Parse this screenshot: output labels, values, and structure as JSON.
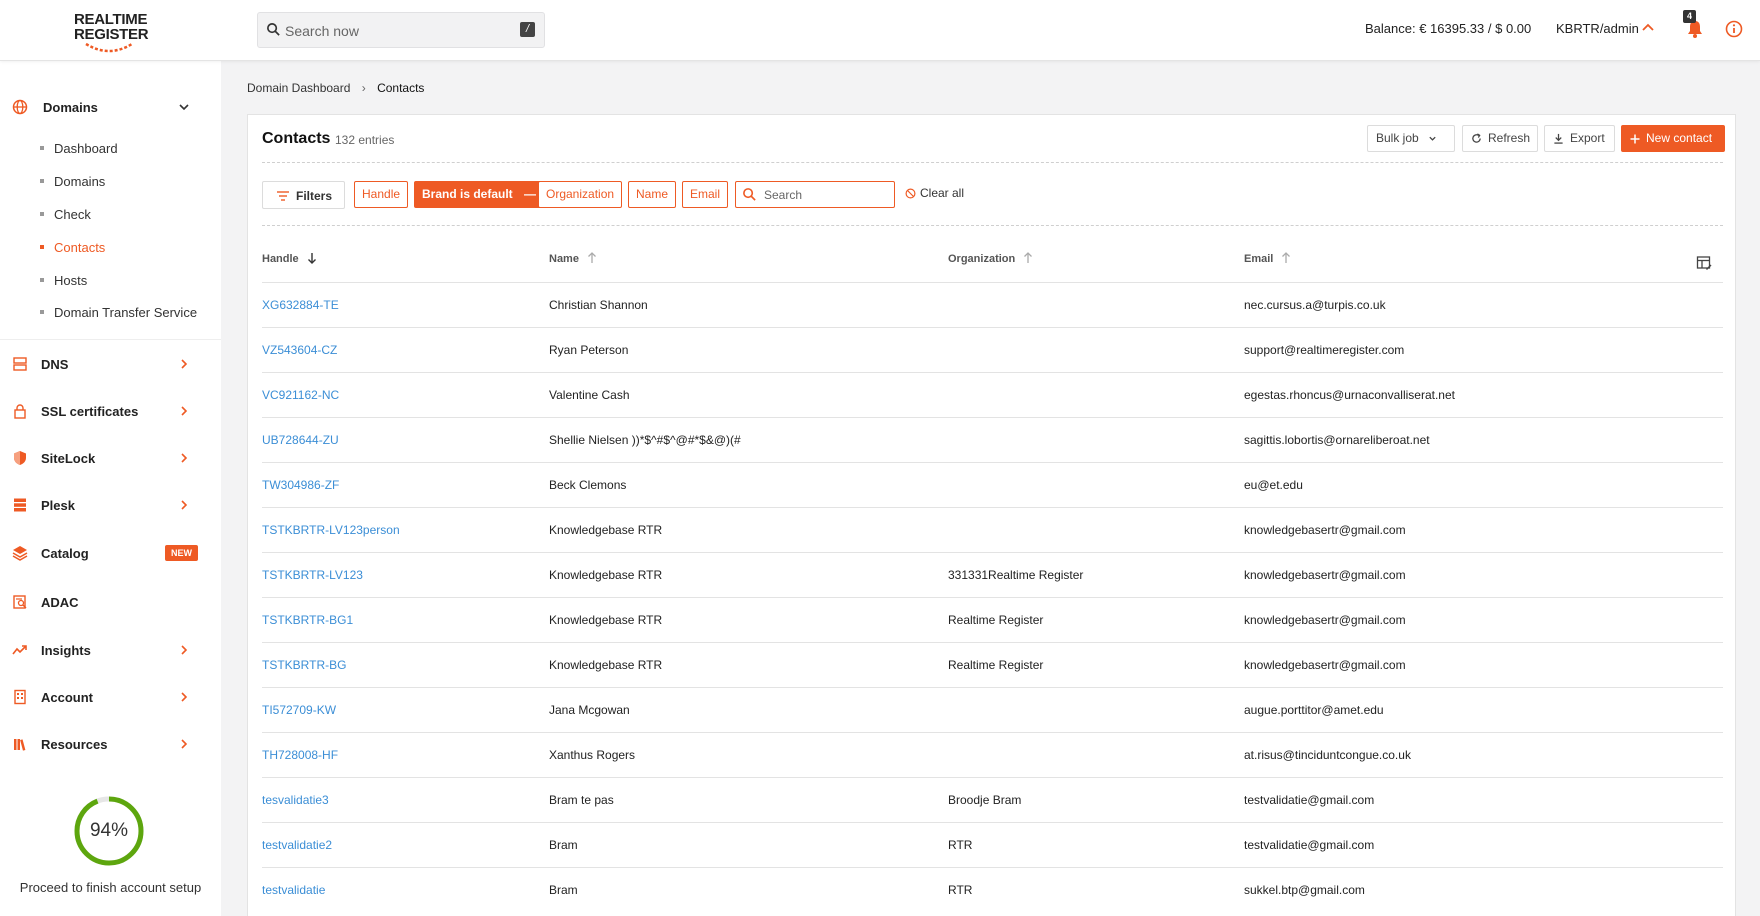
{
  "logo": {
    "line1": "REALTIME",
    "line2": "REGISTER"
  },
  "search": {
    "placeholder": "Search now",
    "shortcut": "/"
  },
  "header": {
    "balance": "Balance: € 16395.33 / $ 0.00",
    "user": "KBRTR/admin",
    "notification_count": "4"
  },
  "colors": {
    "accent": "#ee5a24",
    "link": "#3b8ed6",
    "progress": "#5da60e"
  },
  "sidebar": {
    "domains_label": "Domains",
    "sub_items": [
      {
        "label": "Dashboard",
        "active": false
      },
      {
        "label": "Domains",
        "active": false
      },
      {
        "label": "Check",
        "active": false
      },
      {
        "label": "Contacts",
        "active": true
      },
      {
        "label": "Hosts",
        "active": false
      },
      {
        "label": "Domain Transfer Service",
        "active": false
      }
    ],
    "items": [
      {
        "label": "DNS",
        "icon": "server-icon",
        "chevron": true
      },
      {
        "label": "SSL certificates",
        "icon": "lock-icon",
        "chevron": true
      },
      {
        "label": "SiteLock",
        "icon": "shield-icon",
        "chevron": true
      },
      {
        "label": "Plesk",
        "icon": "database-icon",
        "chevron": true
      },
      {
        "label": "Catalog",
        "icon": "layers-icon",
        "badge": "NEW"
      },
      {
        "label": "ADAC",
        "icon": "search-document-icon"
      },
      {
        "label": "Insights",
        "icon": "trend-icon",
        "chevron": true
      },
      {
        "label": "Account",
        "icon": "building-icon",
        "chevron": true
      },
      {
        "label": "Resources",
        "icon": "library-icon",
        "chevron": true
      }
    ],
    "setup_progress": {
      "percent_label": "94%",
      "value": 0.94,
      "label": "Proceed to finish account setup"
    }
  },
  "breadcrumb": {
    "parent": "Domain Dashboard",
    "current": "Contacts"
  },
  "contacts": {
    "title": "Contacts",
    "count": "132 entries",
    "buttons": {
      "bulk": "Bulk job",
      "refresh": "Refresh",
      "export": "Export",
      "new": "New contact"
    },
    "filters": {
      "label": "Filters",
      "chips": [
        "Handle",
        "Brand is default",
        "Organization",
        "Name",
        "Email"
      ],
      "search_placeholder": "Search",
      "clear": "Clear all"
    },
    "columns": [
      "Handle",
      "Name",
      "Organization",
      "Email"
    ],
    "rows": [
      {
        "handle": "XG632884-TE",
        "name": "Christian Shannon",
        "org": "",
        "email": "nec.cursus.a@turpis.co.uk"
      },
      {
        "handle": "VZ543604-CZ",
        "name": "Ryan Peterson",
        "org": "",
        "email": "support@realtimeregister.com"
      },
      {
        "handle": "VC921162-NC",
        "name": "Valentine Cash",
        "org": "",
        "email": "egestas.rhoncus@urnaconvalliserat.net"
      },
      {
        "handle": "UB728644-ZU",
        "name": "Shellie Nielsen ))*$^#$^@#*$&@)(#",
        "org": "",
        "email": "sagittis.lobortis@ornareliberoat.net"
      },
      {
        "handle": "TW304986-ZF",
        "name": "Beck Clemons",
        "org": "",
        "email": "eu@et.edu"
      },
      {
        "handle": "TSTKBRTR-LV123person",
        "name": "Knowledgebase RTR",
        "org": "",
        "email": "knowledgebasertr@gmail.com"
      },
      {
        "handle": "TSTKBRTR-LV123",
        "name": "Knowledgebase RTR",
        "org": "331331Realtime Register",
        "email": "knowledgebasertr@gmail.com"
      },
      {
        "handle": "TSTKBRTR-BG1",
        "name": "Knowledgebase RTR",
        "org": "Realtime Register",
        "email": "knowledgebasertr@gmail.com"
      },
      {
        "handle": "TSTKBRTR-BG",
        "name": "Knowledgebase RTR",
        "org": "Realtime Register",
        "email": "knowledgebasertr@gmail.com"
      },
      {
        "handle": "TI572709-KW",
        "name": "Jana Mcgowan",
        "org": "",
        "email": "augue.porttitor@amet.edu"
      },
      {
        "handle": "TH728008-HF",
        "name": "Xanthus Rogers",
        "org": "",
        "email": "at.risus@tinciduntcongue.co.uk"
      },
      {
        "handle": "tesvalidatie3",
        "name": "Bram te pas",
        "org": "Broodje Bram",
        "email": "testvalidatie@gmail.com"
      },
      {
        "handle": "testvalidatie2",
        "name": "Bram",
        "org": "RTR",
        "email": "testvalidatie@gmail.com"
      },
      {
        "handle": "testvalidatie",
        "name": "Bram",
        "org": "RTR",
        "email": "sukkel.btp@gmail.com"
      }
    ]
  }
}
